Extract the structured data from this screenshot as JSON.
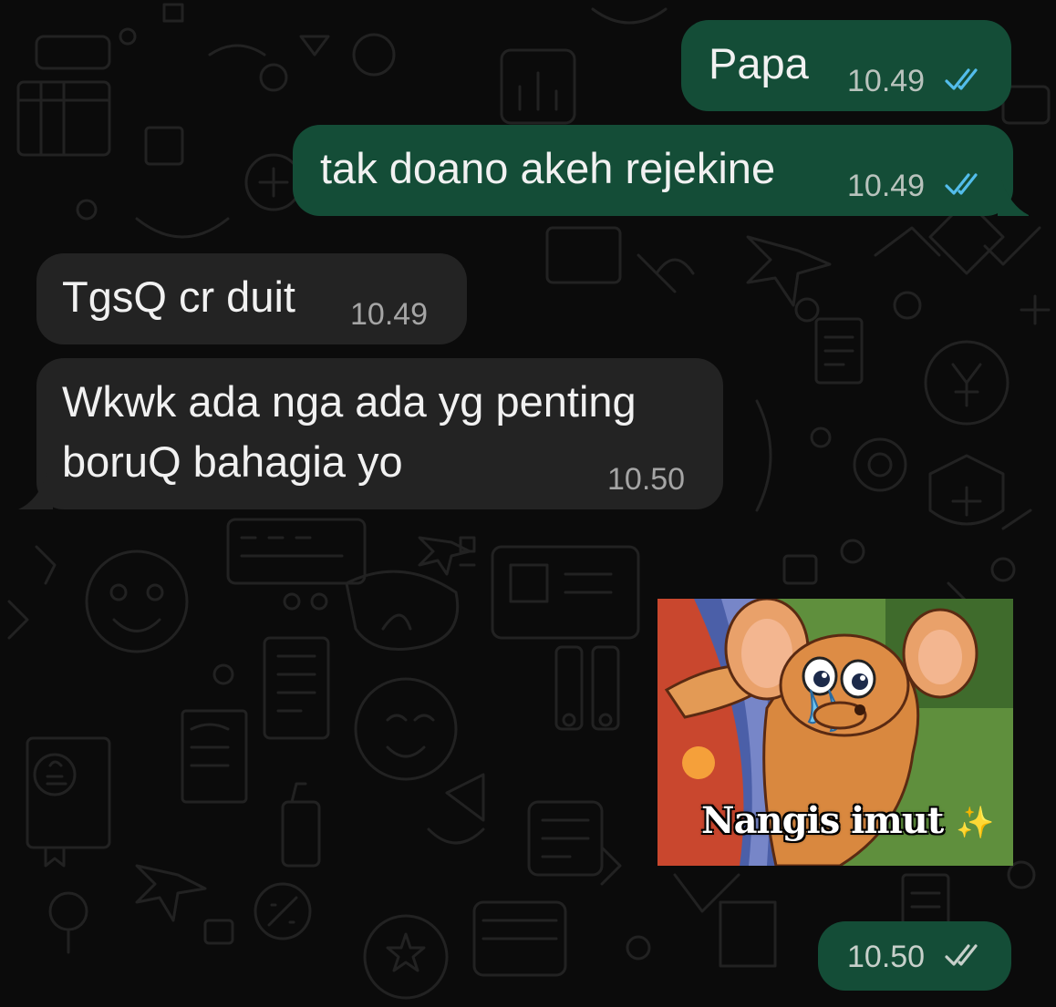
{
  "colors": {
    "background": "#0b0b0b",
    "outgoing_bubble": "#144d37",
    "incoming_bubble": "#232323",
    "read_ticks": "#53bdeb",
    "delivered_ticks": "#c7d0ca"
  },
  "messages": [
    {
      "direction": "outgoing",
      "text": "Papa",
      "time": "10.49",
      "status": "read"
    },
    {
      "direction": "outgoing",
      "text": "tak doano akeh rejekine",
      "time": "10.49",
      "status": "read"
    },
    {
      "direction": "incoming",
      "text": "TgsQ cr duit",
      "time": "10.49"
    },
    {
      "direction": "incoming",
      "text_line1": "Wkwk ada nga ada yg penting",
      "text_line2": "boruQ bahagia yo",
      "time": "10.50"
    },
    {
      "direction": "outgoing",
      "type": "sticker",
      "sticker_caption": "Nangis imut",
      "sticker_icon": "sparkles-icon"
    },
    {
      "direction": "outgoing",
      "type": "time-only",
      "time": "10.50",
      "status": "delivered"
    }
  ]
}
